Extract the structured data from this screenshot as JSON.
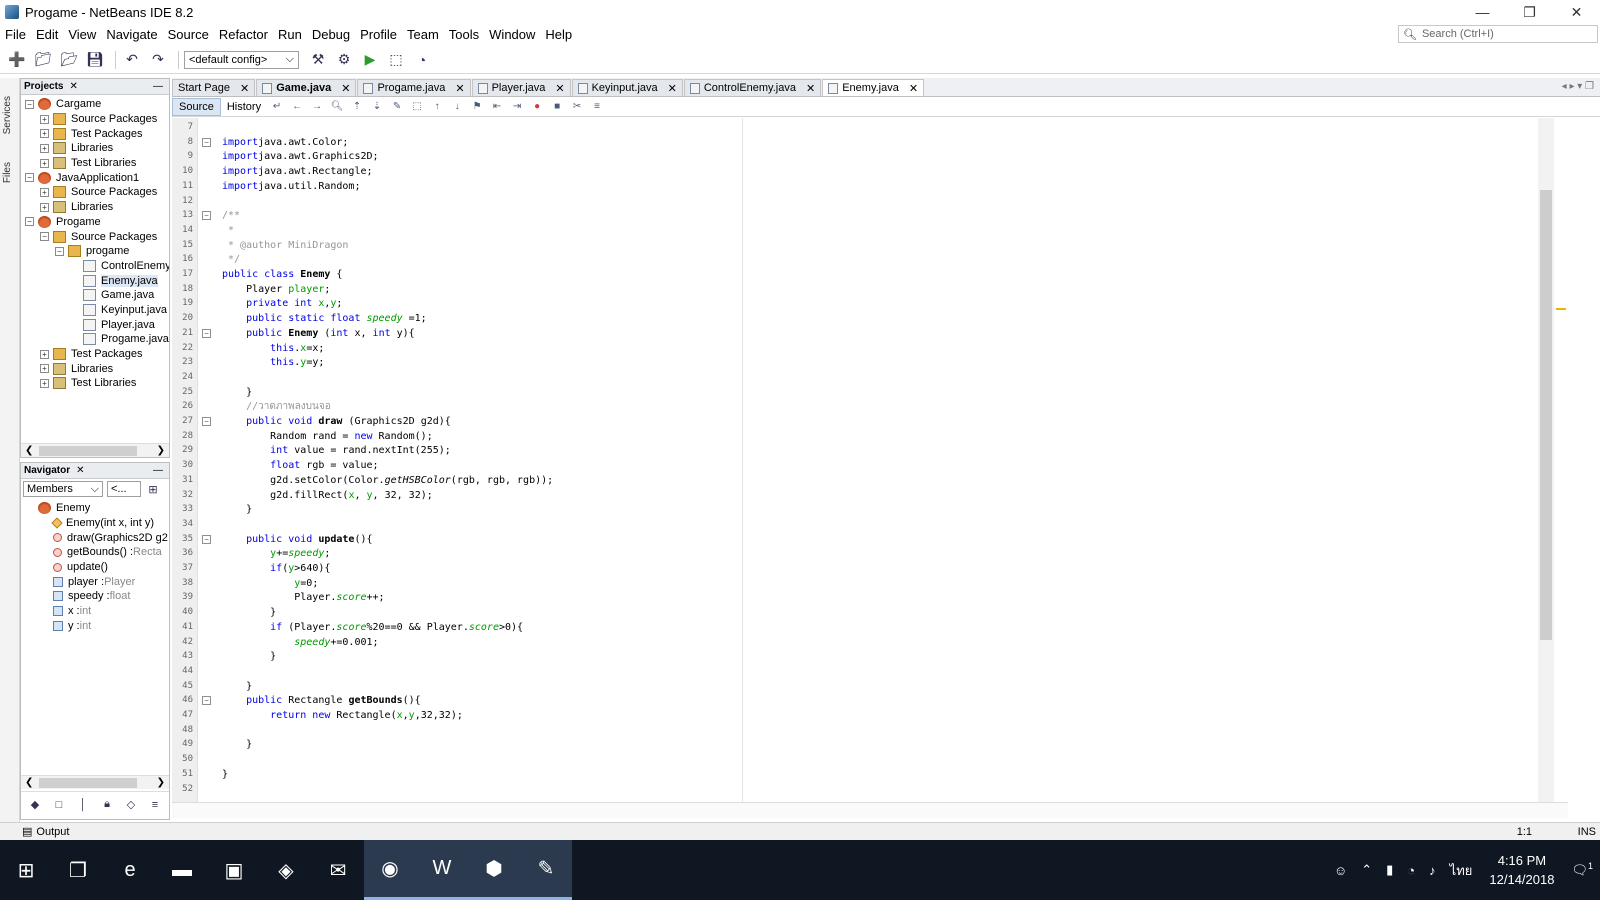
{
  "window": {
    "title": "Progame - NetBeans IDE 8.2",
    "controls": [
      "—",
      "❐",
      "✕"
    ]
  },
  "menu": [
    "File",
    "Edit",
    "View",
    "Navigate",
    "Source",
    "Refactor",
    "Run",
    "Debug",
    "Profile",
    "Team",
    "Tools",
    "Window",
    "Help"
  ],
  "search": {
    "placeholder": "Search (Ctrl+I)"
  },
  "toolbar": {
    "config": "<default config>"
  },
  "side_tabs": [
    "Services",
    "Files"
  ],
  "projects_panel": {
    "title": "Projects",
    "items": [
      {
        "label": "Cargame",
        "level": 0,
        "icon": "project-icon",
        "expanded": true
      },
      {
        "label": "Source Packages",
        "level": 1,
        "icon": "package-icon",
        "expanded": false
      },
      {
        "label": "Test Packages",
        "level": 1,
        "icon": "package-icon",
        "expanded": false
      },
      {
        "label": "Libraries",
        "level": 1,
        "icon": "library-icon",
        "expanded": false
      },
      {
        "label": "Test Libraries",
        "level": 1,
        "icon": "library-icon",
        "expanded": false
      },
      {
        "label": "JavaApplication1",
        "level": 0,
        "icon": "project-icon",
        "expanded": true
      },
      {
        "label": "Source Packages",
        "level": 1,
        "icon": "package-icon",
        "expanded": false
      },
      {
        "label": "Libraries",
        "level": 1,
        "icon": "library-icon",
        "expanded": false
      },
      {
        "label": "Progame",
        "level": 0,
        "icon": "project-icon",
        "expanded": true
      },
      {
        "label": "Source Packages",
        "level": 1,
        "icon": "package-icon",
        "expanded": true
      },
      {
        "label": "progame",
        "level": 2,
        "icon": "package-icon",
        "expanded": true
      },
      {
        "label": "ControlEnemy",
        "level": 3,
        "icon": "java-file-icon"
      },
      {
        "label": "Enemy.java",
        "level": 3,
        "icon": "java-file-icon",
        "selected": true
      },
      {
        "label": "Game.java",
        "level": 3,
        "icon": "java-file-icon"
      },
      {
        "label": "Keyinput.java",
        "level": 3,
        "icon": "java-file-icon"
      },
      {
        "label": "Player.java",
        "level": 3,
        "icon": "java-file-icon"
      },
      {
        "label": "Progame.java",
        "level": 3,
        "icon": "java-file-icon"
      },
      {
        "label": "Test Packages",
        "level": 1,
        "icon": "package-icon",
        "expanded": false
      },
      {
        "label": "Libraries",
        "level": 1,
        "icon": "library-icon",
        "expanded": false
      },
      {
        "label": "Test Libraries",
        "level": 1,
        "icon": "library-icon",
        "expanded": false
      }
    ]
  },
  "navigator_panel": {
    "title": "Navigator",
    "filter": "Members",
    "filter2": "<...",
    "items": [
      {
        "label": "Enemy",
        "type": "",
        "level": 0,
        "icon": "class-icon"
      },
      {
        "label": "Enemy(int x, int y)",
        "type": "",
        "level": 1,
        "icon": "constructor-icon"
      },
      {
        "label": "draw(Graphics2D g2",
        "type": "",
        "level": 1,
        "icon": "method-icon"
      },
      {
        "label": "getBounds() : ",
        "type": "Recta",
        "level": 1,
        "icon": "method-icon"
      },
      {
        "label": "update()",
        "type": "",
        "level": 1,
        "icon": "method-icon"
      },
      {
        "label": "player : ",
        "type": "Player",
        "level": 1,
        "icon": "field-icon"
      },
      {
        "label": "speedy : ",
        "type": "float",
        "level": 1,
        "icon": "static-field-icon"
      },
      {
        "label": "x : ",
        "type": "int",
        "level": 1,
        "icon": "field-icon"
      },
      {
        "label": "y : ",
        "type": "int",
        "level": 1,
        "icon": "field-icon"
      }
    ]
  },
  "editor": {
    "tabs": [
      {
        "label": "Start Page",
        "active": false,
        "bold": false,
        "icon": false
      },
      {
        "label": "Game.java",
        "active": false,
        "bold": true,
        "icon": true
      },
      {
        "label": "Progame.java",
        "active": false,
        "bold": false,
        "icon": true
      },
      {
        "label": "Player.java",
        "active": false,
        "bold": false,
        "icon": true
      },
      {
        "label": "Keyinput.java",
        "active": false,
        "bold": false,
        "icon": true
      },
      {
        "label": "ControlEnemy.java",
        "active": false,
        "bold": false,
        "icon": true
      },
      {
        "label": "Enemy.java",
        "active": true,
        "bold": false,
        "icon": true
      }
    ],
    "modes": [
      "Source",
      "History"
    ],
    "first_line": 7,
    "lines": [
      [],
      [
        [
          "kw",
          "import"
        ],
        [
          "",
          "java.awt.Color;"
        ]
      ],
      [
        [
          "kw",
          "import"
        ],
        [
          "",
          "java.awt.Graphics2D;"
        ]
      ],
      [
        [
          "kw",
          "import"
        ],
        [
          "",
          "java.awt.Rectangle;"
        ]
      ],
      [
        [
          "kw",
          "import"
        ],
        [
          "",
          "java.util.Random;"
        ]
      ],
      [],
      [
        [
          "cmt",
          "/**"
        ]
      ],
      [
        [
          "cmt",
          " *"
        ]
      ],
      [
        [
          "cmt",
          " * @author MiniDragon"
        ]
      ],
      [
        [
          "cmt",
          " */"
        ]
      ],
      [
        [
          "kw",
          "public class "
        ],
        [
          "bold",
          "Enemy"
        ],
        [
          "",
          " {"
        ]
      ],
      [
        [
          "",
          "    Player "
        ],
        [
          "fld",
          "player"
        ],
        [
          "",
          ";"
        ]
      ],
      [
        [
          "kw",
          "    private int "
        ],
        [
          "fld",
          "x"
        ],
        [
          "",
          ","
        ],
        [
          "fld",
          "y"
        ],
        [
          "",
          ";"
        ]
      ],
      [
        [
          "kw",
          "    public static float "
        ],
        [
          "sfld",
          "speedy"
        ],
        [
          "",
          " =1;"
        ]
      ],
      [
        [
          "kw",
          "    public "
        ],
        [
          "bold",
          "Enemy"
        ],
        [
          "",
          " ("
        ],
        [
          "kw",
          "int"
        ],
        [
          "",
          " x, "
        ],
        [
          "kw",
          "int"
        ],
        [
          "",
          " y){"
        ]
      ],
      [
        [
          "kw",
          "        this"
        ],
        [
          "",
          "."
        ],
        [
          "fld",
          "x"
        ],
        [
          "",
          "=x;"
        ]
      ],
      [
        [
          "kw",
          "        this"
        ],
        [
          "",
          "."
        ],
        [
          "fld",
          "y"
        ],
        [
          "",
          "=y;"
        ]
      ],
      [],
      [
        [
          "",
          "    }"
        ]
      ],
      [
        [
          "cmt",
          "    //วาดภาพลงบนจอ"
        ]
      ],
      [
        [
          "kw",
          "    public void "
        ],
        [
          "bold",
          "draw"
        ],
        [
          "",
          " (Graphics2D g2d){"
        ]
      ],
      [
        [
          "",
          "        Random rand = "
        ],
        [
          "kw",
          "new"
        ],
        [
          "",
          " Random();"
        ]
      ],
      [
        [
          "kw",
          "        int"
        ],
        [
          "",
          " value = rand.nextInt(255);"
        ]
      ],
      [
        [
          "kw",
          "        float"
        ],
        [
          "",
          " rgb = value;"
        ]
      ],
      [
        [
          "",
          "        g2d.setColor(Color."
        ],
        [
          "ital",
          "getHSBColor"
        ],
        [
          "",
          "(rgb, rgb, rgb));"
        ]
      ],
      [
        [
          "",
          "        g2d.fillRect("
        ],
        [
          "fld",
          "x"
        ],
        [
          "",
          ", "
        ],
        [
          "fld",
          "y"
        ],
        [
          "",
          ", 32, 32);"
        ]
      ],
      [
        [
          "",
          "    }"
        ]
      ],
      [],
      [
        [
          "kw",
          "    public void "
        ],
        [
          "bold",
          "update"
        ],
        [
          "",
          "(){"
        ]
      ],
      [
        [
          "",
          "        "
        ],
        [
          "fld",
          "y"
        ],
        [
          "",
          "+="
        ],
        [
          "sfld",
          "speedy"
        ],
        [
          "",
          ";"
        ]
      ],
      [
        [
          "kw",
          "        if"
        ],
        [
          "",
          "("
        ],
        [
          "fld",
          "y"
        ],
        [
          "",
          ">640){"
        ]
      ],
      [
        [
          "",
          "            "
        ],
        [
          "fld",
          "y"
        ],
        [
          "",
          "=0;"
        ]
      ],
      [
        [
          "",
          "            Player."
        ],
        [
          "sfld",
          "score"
        ],
        [
          "",
          "++;"
        ]
      ],
      [
        [
          "",
          "        }"
        ]
      ],
      [
        [
          "kw",
          "        if"
        ],
        [
          "",
          " (Player."
        ],
        [
          "sfld",
          "score"
        ],
        [
          "",
          "%20==0 && Player."
        ],
        [
          "sfld",
          "score"
        ],
        [
          "",
          ">0){"
        ]
      ],
      [
        [
          "",
          "            "
        ],
        [
          "sfld",
          "speedy"
        ],
        [
          "",
          "+=0.001;"
        ]
      ],
      [
        [
          "",
          "        }"
        ]
      ],
      [],
      [
        [
          "",
          "    }"
        ]
      ],
      [
        [
          "kw",
          "    public"
        ],
        [
          "",
          " Rectangle "
        ],
        [
          "bold",
          "getBounds"
        ],
        [
          "",
          "(){"
        ]
      ],
      [
        [
          "kw",
          "        return new"
        ],
        [
          "",
          " Rectangle("
        ],
        [
          "fld",
          "x"
        ],
        [
          "",
          ","
        ],
        [
          "fld",
          "y"
        ],
        [
          "",
          ",32,32);"
        ]
      ],
      [],
      [
        [
          "",
          "    }"
        ]
      ],
      [],
      [
        [
          "",
          "}"
        ]
      ],
      []
    ],
    "fold_lines": [
      8,
      13,
      21,
      27,
      35,
      46
    ]
  },
  "status": {
    "output_label": "Output",
    "position": "1:1",
    "insert_mode": "INS"
  },
  "taskbar": {
    "apps": [
      {
        "name": "start-icon",
        "glyph": "⊞",
        "active": false
      },
      {
        "name": "task-view-icon",
        "glyph": "❐",
        "active": false
      },
      {
        "name": "edge-icon",
        "glyph": "e",
        "active": false
      },
      {
        "name": "file-explorer-icon",
        "glyph": "▬",
        "active": false
      },
      {
        "name": "store-icon",
        "glyph": "▣",
        "active": false
      },
      {
        "name": "garena-icon",
        "glyph": "◈",
        "active": false
      },
      {
        "name": "mail-icon",
        "glyph": "✉",
        "active": false
      },
      {
        "name": "chrome-icon",
        "glyph": "◉",
        "active": true
      },
      {
        "name": "word-icon",
        "glyph": "W",
        "active": true
      },
      {
        "name": "netbeans-icon",
        "glyph": "⬢",
        "active": true
      },
      {
        "name": "paint-icon",
        "glyph": "✎",
        "active": true
      }
    ],
    "language": "ไทย",
    "time": "4:16 PM",
    "date": "12/14/2018",
    "notifications": "1"
  }
}
